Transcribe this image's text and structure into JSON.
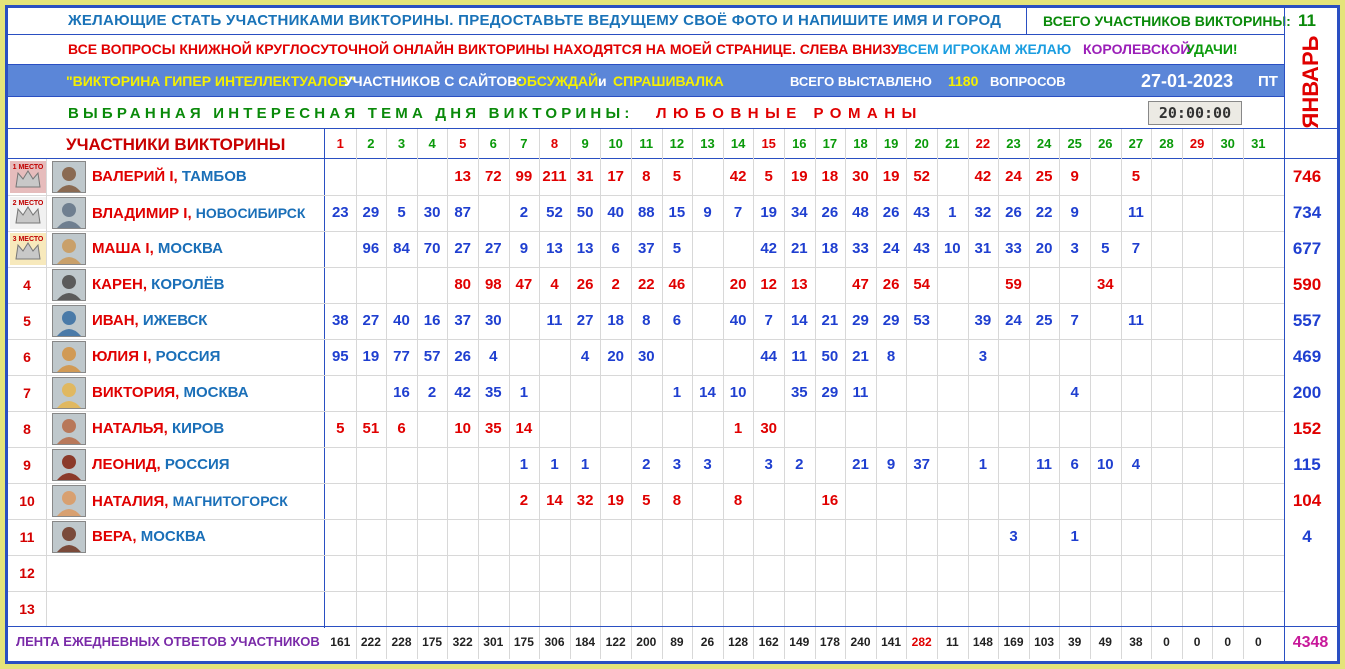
{
  "header": {
    "line1": "ЖЕЛАЮЩИЕ СТАТЬ УЧАСТНИКАМИ ВИКТОРИНЫ. ПРЕДОСТАВЬТЕ ВЕДУЩЕМУ СВОЁ ФОТО И НАПИШИТЕ ИМЯ И ГОРОД",
    "total_participants_label": "ВСЕГО УЧАСТНИКОВ ВИКТОРИНЫ:",
    "total_participants": "11",
    "line2_a": "ВСЕ ВОПРОСЫ КНИЖНОЙ КРУГЛОСУТОЧНОЙ ОНЛАЙН ВИКТОРИНЫ НАХОДЯТСЯ НА МОЕЙ СТРАНИЦЕ. СЛЕВА ВНИЗУ.",
    "line2_b": "ВСЕМ ИГРОКАМ ЖЕЛАЮ",
    "line2_c": "КОРОЛЕВСКОЙ",
    "line2_d": "УДАЧИ!",
    "quiz_name": "\"ВИКТОРИНА ГИПЕР ИНТЕЛЛЕКТУАЛОВ\"",
    "sites_label": "УЧАСТНИКОВ С САЙТОВ:",
    "site1": "ОБСУЖДАЙ",
    "and": "и",
    "site2": "СПРАШИВАЛКА",
    "questions_label": "ВСЕГО ВЫСТАВЛЕНО",
    "questions_count": "1180",
    "questions_word": "ВОПРОСОВ",
    "date": "27-01-2023",
    "weekday": "ПТ",
    "theme_label": "ВЫБРАННАЯ ИНТЕРЕСНАЯ ТЕМА ДНЯ ВИКТОРИНЫ:",
    "theme": "ЛЮБОВНЫЕ РОМАНЫ",
    "clock": "20:00:00",
    "month": "ЯНВАРЬ"
  },
  "table": {
    "title": "УЧАСТНИКИ ВИКТОРИНЫ",
    "days": [
      "1",
      "2",
      "3",
      "4",
      "5",
      "6",
      "7",
      "8",
      "9",
      "10",
      "11",
      "12",
      "13",
      "14",
      "15",
      "16",
      "17",
      "18",
      "19",
      "20",
      "21",
      "22",
      "23",
      "24",
      "25",
      "26",
      "27",
      "28",
      "29",
      "30",
      "31"
    ],
    "medal_labels": [
      "1 МЕСТО",
      "2 МЕСТО",
      "3 МЕСТО"
    ],
    "rows": [
      {
        "rank": "1",
        "name": "ВАЛЕРИЙ I,",
        "city": "ТАМБОВ",
        "total": "746",
        "scores": [
          "",
          "",
          "",
          "",
          "13",
          "72",
          "99",
          "211",
          "31",
          "17",
          "8",
          "5",
          "",
          "42",
          "5",
          "19",
          "18",
          "30",
          "19",
          "52",
          "",
          "42",
          "24",
          "25",
          "9",
          "",
          "5",
          "",
          "",
          "",
          ""
        ]
      },
      {
        "rank": "2",
        "name": "ВЛАДИМИР I,",
        "city": "НОВОСИБИРСК",
        "total": "734",
        "scores": [
          "23",
          "29",
          "5",
          "30",
          "87",
          "",
          "2",
          "52",
          "50",
          "40",
          "88",
          "15",
          "9",
          "7",
          "19",
          "34",
          "26",
          "48",
          "26",
          "43",
          "1",
          "32",
          "26",
          "22",
          "9",
          "",
          "11",
          "",
          "",
          "",
          ""
        ]
      },
      {
        "rank": "3",
        "name": "МАША I,",
        "city": "МОСКВА",
        "total": "677",
        "scores": [
          "",
          "96",
          "84",
          "70",
          "27",
          "27",
          "9",
          "13",
          "13",
          "6",
          "37",
          "5",
          "",
          "",
          "42",
          "21",
          "18",
          "33",
          "24",
          "43",
          "10",
          "31",
          "33",
          "20",
          "3",
          "5",
          "7",
          "",
          "",
          "",
          ""
        ]
      },
      {
        "rank": "4",
        "name": "КАРЕН,",
        "city": "КОРОЛЁВ",
        "total": "590",
        "scores": [
          "",
          "",
          "",
          "",
          "80",
          "98",
          "47",
          "4",
          "26",
          "2",
          "22",
          "46",
          "",
          "20",
          "12",
          "13",
          "",
          "47",
          "26",
          "54",
          "",
          "",
          "59",
          "",
          "",
          "34",
          "",
          "",
          "",
          "",
          ""
        ]
      },
      {
        "rank": "5",
        "name": "ИВАН,",
        "city": "ИЖЕВСК",
        "total": "557",
        "scores": [
          "38",
          "27",
          "40",
          "16",
          "37",
          "30",
          "",
          "11",
          "27",
          "18",
          "8",
          "6",
          "",
          "40",
          "7",
          "14",
          "21",
          "29",
          "29",
          "53",
          "",
          "39",
          "24",
          "25",
          "7",
          "",
          "11",
          "",
          "",
          "",
          ""
        ]
      },
      {
        "rank": "6",
        "name": "ЮЛИЯ I,",
        "city": "РОССИЯ",
        "total": "469",
        "scores": [
          "95",
          "19",
          "77",
          "57",
          "26",
          "4",
          "",
          "",
          "4",
          "20",
          "30",
          "",
          "",
          "",
          "44",
          "11",
          "50",
          "21",
          "8",
          "",
          "",
          "3",
          "",
          "",
          "",
          "",
          "",
          "",
          "",
          "",
          ""
        ]
      },
      {
        "rank": "7",
        "name": "ВИКТОРИЯ,",
        "city": "МОСКВА",
        "total": "200",
        "scores": [
          "",
          "",
          "16",
          "2",
          "42",
          "35",
          "1",
          "",
          "",
          "",
          "",
          "1",
          "14",
          "10",
          "",
          "35",
          "29",
          "11",
          "",
          "",
          "",
          "",
          "",
          "",
          "4",
          "",
          "",
          "",
          "",
          "",
          ""
        ]
      },
      {
        "rank": "8",
        "name": "НАТАЛЬЯ,",
        "city": "КИРОВ",
        "total": "152",
        "scores": [
          "5",
          "51",
          "6",
          "",
          "10",
          "35",
          "14",
          "",
          "",
          "",
          "",
          "",
          "",
          "1",
          "30",
          "",
          "",
          "",
          "",
          "",
          "",
          "",
          "",
          "",
          "",
          "",
          "",
          "",
          "",
          "",
          ""
        ]
      },
      {
        "rank": "9",
        "name": "ЛЕОНИД,",
        "city": "РОССИЯ",
        "total": "115",
        "scores": [
          "",
          "",
          "",
          "",
          "",
          "",
          "1",
          "1",
          "1",
          "",
          "2",
          "3",
          "3",
          "",
          "3",
          "2",
          "",
          "21",
          "9",
          "37",
          "",
          "1",
          "",
          "11",
          "6",
          "10",
          "4",
          "",
          "",
          "",
          ""
        ]
      },
      {
        "rank": "10",
        "name": "НАТАЛИЯ,",
        "city": "МАГНИТОГОРСК",
        "total": "104",
        "scores": [
          "",
          "",
          "",
          "",
          "",
          "",
          "2",
          "14",
          "32",
          "19",
          "5",
          "8",
          "",
          "8",
          "",
          "",
          "16",
          "",
          "",
          "",
          "",
          "",
          "",
          "",
          "",
          "",
          "",
          "",
          "",
          "",
          ""
        ]
      },
      {
        "rank": "11",
        "name": "ВЕРА,",
        "city": "МОСКВА",
        "total": "4",
        "scores": [
          "",
          "",
          "",
          "",
          "",
          "",
          "",
          "",
          "",
          "",
          "",
          "",
          "",
          "",
          "",
          "",
          "",
          "",
          "",
          "",
          "",
          "",
          "3",
          "",
          "1",
          "",
          "",
          "",
          "",
          "",
          ""
        ]
      },
      {
        "rank": "12",
        "name": "",
        "city": "",
        "total": "",
        "scores": []
      },
      {
        "rank": "13",
        "name": "",
        "city": "",
        "total": "",
        "scores": []
      }
    ],
    "footer_label": "ЛЕНТА ЕЖЕДНЕВНЫХ ОТВЕТОВ УЧАСТНИКОВ",
    "daily_totals": [
      "161",
      "222",
      "228",
      "175",
      "322",
      "301",
      "175",
      "306",
      "184",
      "122",
      "200",
      "89",
      "26",
      "128",
      "162",
      "149",
      "178",
      "240",
      "141",
      "282",
      "11",
      "148",
      "169",
      "103",
      "39",
      "49",
      "38",
      "0",
      "0",
      "0",
      "0"
    ],
    "grand_total": "4348"
  },
  "colors": {
    "border_blue": "#2a4fc2",
    "red": "#e00000",
    "blue": "#1f3fd0",
    "green": "#0a8a0a",
    "purple": "#7a2aa8",
    "yellow": "#f5f000",
    "teal": "#1a73b8"
  }
}
